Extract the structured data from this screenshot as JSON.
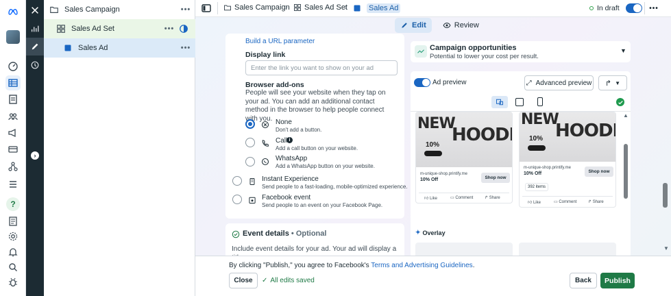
{
  "rail": {
    "icons": [
      "meta-logo-icon",
      "chart-icon",
      "avatar",
      "gauge-icon",
      "table-icon",
      "pages-icon",
      "people-icon",
      "megaphone-icon",
      "card-icon",
      "network-icon",
      "menu-icon",
      "help-icon",
      "document-icon",
      "settings-icon",
      "bell-icon",
      "search-icon",
      "bug-icon"
    ]
  },
  "tree": {
    "campaign": "Sales Campaign",
    "adset": "Sales Ad Set",
    "ad": "Sales Ad",
    "more": "•••"
  },
  "topbar": {
    "crumbs": [
      "Sales Campaign",
      "Sales Ad Set",
      "Sales Ad"
    ],
    "status": "In draft",
    "more": "•••"
  },
  "tabs": {
    "edit": "Edit",
    "review": "Review"
  },
  "form": {
    "url_param_link": "Build a URL parameter",
    "display_link_label": "Display link",
    "display_link_placeholder": "Enter the link you want to show on your ad",
    "addons_title": "Browser add-ons",
    "addons_desc": "People will see your website when they tap on your ad. You can add an additional contact method in the browser to help people connect with you.",
    "options": [
      {
        "title": "None",
        "sub": "Don't add a button.",
        "selected": true
      },
      {
        "title": "Call",
        "sub": "Add a call button on your website.",
        "selected": false
      },
      {
        "title": "WhatsApp",
        "sub": "Add a WhatsApp button on your website.",
        "selected": false
      },
      {
        "title": "Instant Experience",
        "sub": "Send people to a fast-loading, mobile-optimized experience.",
        "selected": false
      },
      {
        "title": "Facebook event",
        "sub": "Send people to an event on your Facebook Page.",
        "selected": false
      }
    ]
  },
  "event": {
    "title": "Event details",
    "optional": " • Optional",
    "desc": "Include event details for your ad. Your ad will display a title,"
  },
  "opportunities": {
    "title": "Campaign opportunities",
    "sub": "Potential to lower your cost per result."
  },
  "preview": {
    "label": "Ad preview",
    "advanced": "Advanced preview",
    "overlay": "Overlay",
    "cards": [
      {
        "domain": "m-unique-shop.printify.me",
        "offer": "10% Off",
        "cta": "Shop now",
        "brand_big": "NEW",
        "brand_big2": "HOODIE",
        "pct": "10%",
        "items": ""
      },
      {
        "domain": "m-unique-shop.printify.me",
        "offer": "10% Off",
        "cta": "Shop now",
        "brand_big": "NEW",
        "brand_big2": "HOODIE",
        "pct": "10%",
        "items": "392 items"
      }
    ],
    "actions": [
      "Like",
      "Comment",
      "Share"
    ]
  },
  "bottom": {
    "agree_prefix": "By clicking \"Publish,\" you agree to Facebook's ",
    "terms": "Terms and Advertising Guidelines",
    "agree_suffix": ".",
    "close": "Close",
    "saved": "All edits saved",
    "back": "Back",
    "publish": "Publish"
  },
  "colors": {
    "accent": "#1a66c2",
    "publish": "#1f7a46",
    "draft_dot": "#31a24c"
  }
}
